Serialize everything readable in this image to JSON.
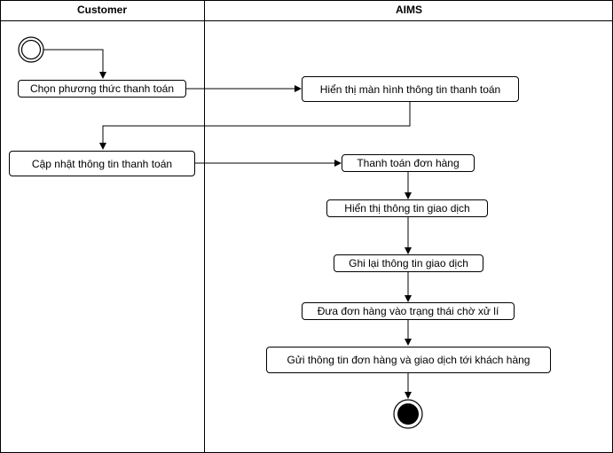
{
  "lanes": [
    {
      "title": "Customer"
    },
    {
      "title": "AIMS"
    }
  ],
  "nodes": {
    "choose_payment": "Chọn phương thức thanh toán",
    "show_payment_screen": "Hiển thị màn hình thông tin thanh toán",
    "update_payment_info": "Cập nhật thông tin thanh toán",
    "pay_order": "Thanh toán đơn hàng",
    "show_transaction": "Hiển thị thông tin giao dịch",
    "record_transaction": "Ghi lại thông tin giao dịch",
    "set_pending": "Đưa đơn hàng vào trạng thái chờ xử lí",
    "send_info": "Gửi thông tin đơn hàng và giao dịch tới khách hàng"
  },
  "colors": {
    "line": "#000000",
    "background": "#ffffff"
  }
}
